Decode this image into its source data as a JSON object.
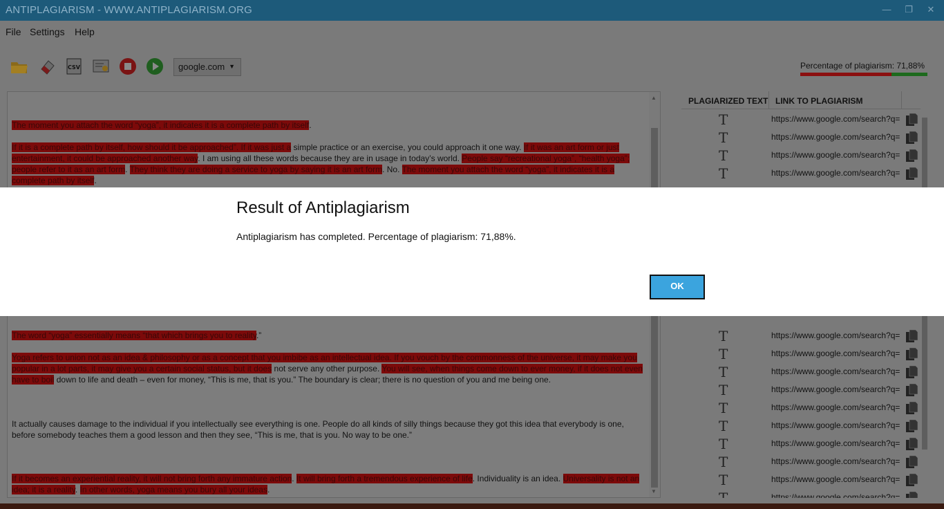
{
  "window": {
    "title": "ANTIPLAGIARISM - WWW.ANTIPLAGIARISM.ORG"
  },
  "menu": [
    "File",
    "Settings",
    "Help"
  ],
  "toolbar": {
    "icons": [
      "open-folder-icon",
      "eraser-icon",
      "csv-icon",
      "certificate-icon",
      "stop-icon",
      "play-icon"
    ],
    "search_engine": "google.com"
  },
  "plagiarism": {
    "label": "Percentage of plagiarism: 71,88%",
    "fraction": 0.7188
  },
  "text": {
    "p1": [
      {
        "t": "The moment you attach the word “yoga”, it indicates it is a complete path by itself",
        "h": true
      },
      {
        "t": ".",
        "h": false
      }
    ],
    "p2": [
      {
        "t": "If it is a complete path by itself, how should it be approached”. If it was just a",
        "h": true
      },
      {
        "t": " simple practice or an exercise, you could approach it one way. ",
        "h": false
      },
      {
        "t": "If it was an art form or just entertainment, it could be approached another way",
        "h": true
      },
      {
        "t": ". I am using all these words because they are in usage in today’s world. ",
        "h": false
      },
      {
        "t": "People say “recreational yoga”, “health yoga”; people refer to it as an art form",
        "h": true
      },
      {
        "t": ". ",
        "h": false
      },
      {
        "t": "They think they are doing a service to yoga by saying it is an art form",
        "h": true
      },
      {
        "t": ". No. ",
        "h": false
      },
      {
        "t": "The moment you attach the word “yoga”, it indicates it is a complete path by itself",
        "h": true
      },
      {
        "t": ".",
        "h": false
      }
    ],
    "p3": [
      {
        "t": "The word “yoga” essentially means “that which brings you to reality",
        "h": true
      },
      {
        "t": ".”",
        "h": false
      }
    ],
    "p4": [
      {
        "t": "Yoga refers to union not as an idea & philosophy or as a concept that you imbibe",
        "h": true
      },
      {
        "t": " as an intellectual idea. If you vouch by the commonness of the universe, it may make you popular in a lot parts, it may give you a certain social status, but it does",
        "h": true
      },
      {
        "t": " not serve any other purpose. ",
        "h": false
      },
      {
        "t": "You will see, when things come down to ever money, if it does not even have to boil",
        "h": true
      },
      {
        "t": " down to life and death – even for money, “This is me, that is you.” The boundary is clear; there is no question of you and me being one.",
        "h": false
      }
    ],
    "p5": [
      {
        "t": "It actually causes damage to the individual if you intellectually see everything is one. People do all kinds of silly things because they got this idea that everybody is one, before somebody teaches them a good lesson and then they see, “This is me, that is you. No way to be one.”",
        "h": false
      }
    ],
    "p6": [
      {
        "t": "If it becomes an experiential reality, it will not bring forth any immature action",
        "h": true
      },
      {
        "t": ". ",
        "h": false
      },
      {
        "t": "It will bring forth a tremendous experience of life",
        "h": true
      },
      {
        "t": ". Individuality is an idea. ",
        "h": false
      },
      {
        "t": "Universality is not an idea; it is a reality",
        "h": true
      },
      {
        "t": ". ",
        "h": false
      },
      {
        "t": "In other words, yoga means you bury all your ideas",
        "h": true
      },
      {
        "t": ".",
        "h": false
      }
    ]
  },
  "results": {
    "col_plagiarized": "PLAGIARIZED TEXT",
    "col_link": "LINK TO PLAGIARISM",
    "link_text": "https://www.google.com/search?q=",
    "partial_link_text": "https://www.google.com/search?q=",
    "row_count": 4,
    "lower_row_count": 10
  },
  "dialog": {
    "title": "Result of Antiplagiarism",
    "message": "Antiplagiarism has completed. Percentage of plagiarism: 71,88%.",
    "ok_label": "OK"
  }
}
